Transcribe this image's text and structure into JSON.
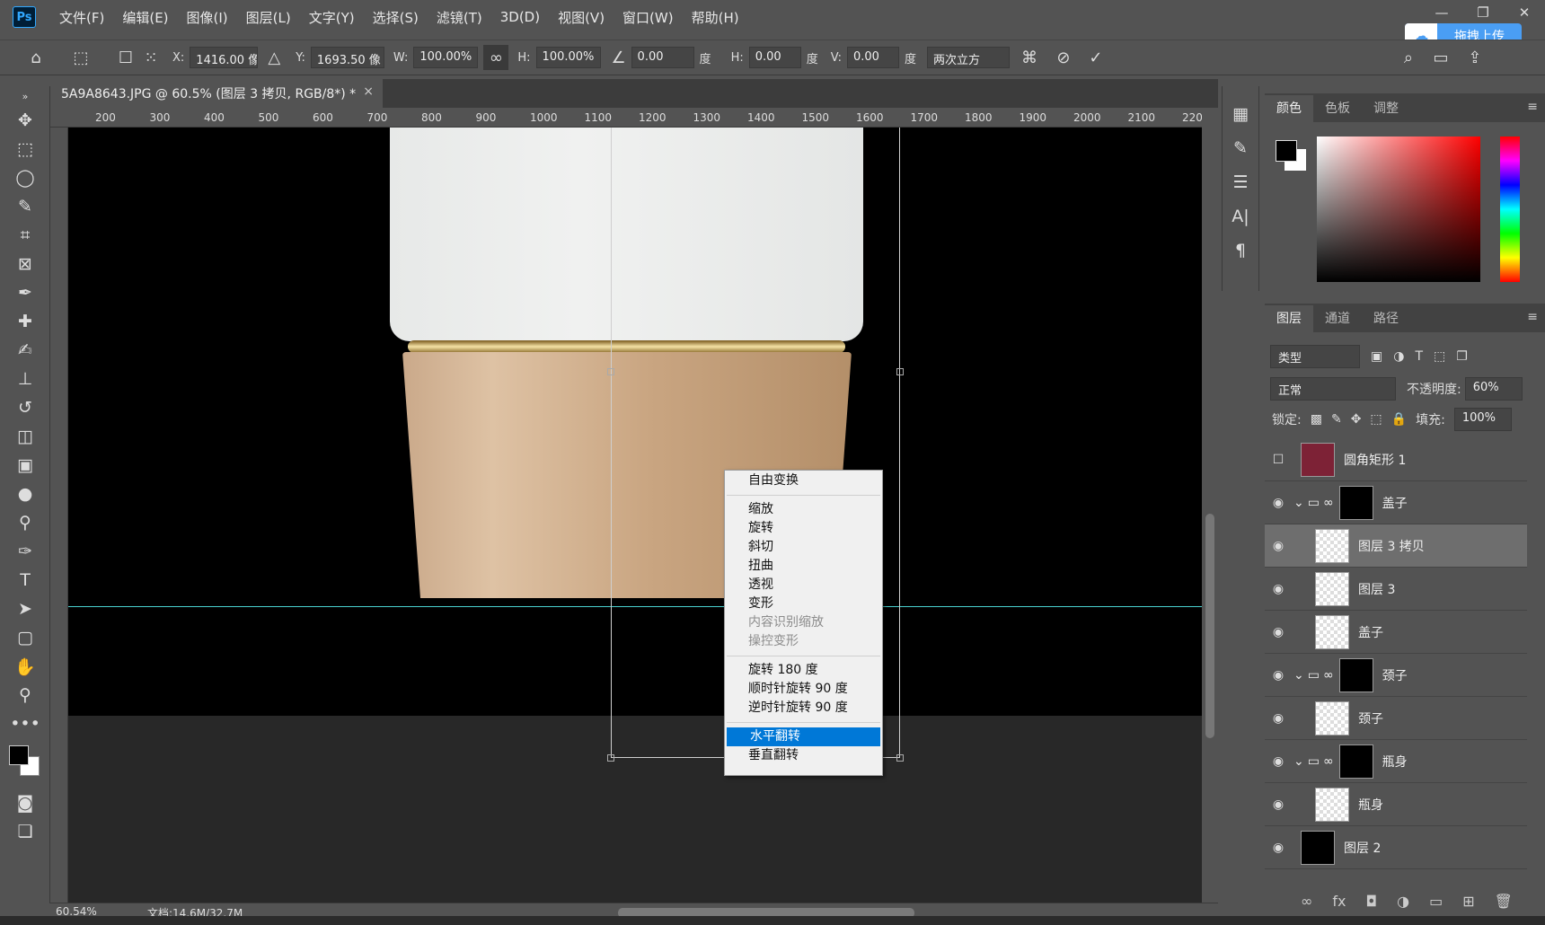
{
  "menu": {
    "items": [
      "文件(F)",
      "编辑(E)",
      "图像(I)",
      "图层(L)",
      "文字(Y)",
      "选择(S)",
      "滤镜(T)",
      "3D(D)",
      "视图(V)",
      "窗口(W)",
      "帮助(H)"
    ],
    "upload": "拖拽上传"
  },
  "options": {
    "x_label": "X:",
    "x_value": "1416.00 像",
    "y_label": "Y:",
    "y_value": "1693.50 像",
    "w_label": "W:",
    "w_value": "100.00%",
    "h_label": "H:",
    "h_value": "100.00%",
    "angle_value": "0.00",
    "deg": "度",
    "hskew_label": "H:",
    "hskew_value": "0.00",
    "vskew_label": "V:",
    "vskew_value": "0.00",
    "interp": "两次立方"
  },
  "document": {
    "tab_title": "5A9A8643.JPG @ 60.5% (图层 3 拷贝, RGB/8*) *",
    "zoom": "60.54%",
    "doc_info": "文档:14.6M/32.7M"
  },
  "ruler": {
    "ticks": [
      "200",
      "300",
      "400",
      "500",
      "600",
      "700",
      "800",
      "900",
      "1000",
      "1100",
      "1200",
      "1300",
      "1400",
      "1500",
      "1600",
      "1700",
      "1800",
      "1900",
      "2000",
      "2100",
      "220"
    ]
  },
  "context_menu": {
    "free_transform": "自由变换",
    "scale": "缩放",
    "rotate": "旋转",
    "skew": "斜切",
    "distort": "扭曲",
    "perspective": "透视",
    "warp": "变形",
    "content_aware": "内容识别缩放",
    "puppet": "操控变形",
    "rot180": "旋转 180 度",
    "rot_cw": "顺时针旋转 90 度",
    "rot_ccw": "逆时针旋转 90 度",
    "flip_h": "水平翻转",
    "flip_v": "垂直翻转"
  },
  "color_panel": {
    "tabs": [
      "颜色",
      "色板",
      "调整"
    ]
  },
  "layers_panel": {
    "tabs": [
      "图层",
      "通道",
      "路径"
    ],
    "filter": "类型",
    "blend": "正常",
    "opacity_label": "不透明度:",
    "opacity": "60%",
    "lock_label": "锁定:",
    "fill_label": "填充:",
    "fill": "100%",
    "layers": [
      {
        "name": "圆角矩形 1"
      },
      {
        "name": "盖子"
      },
      {
        "name": "图层 3 拷贝"
      },
      {
        "name": "图层 3"
      },
      {
        "name": "盖子"
      },
      {
        "name": "颈子"
      },
      {
        "name": "颈子"
      },
      {
        "name": "瓶身"
      },
      {
        "name": "瓶身"
      },
      {
        "name": "图层 2"
      }
    ]
  }
}
